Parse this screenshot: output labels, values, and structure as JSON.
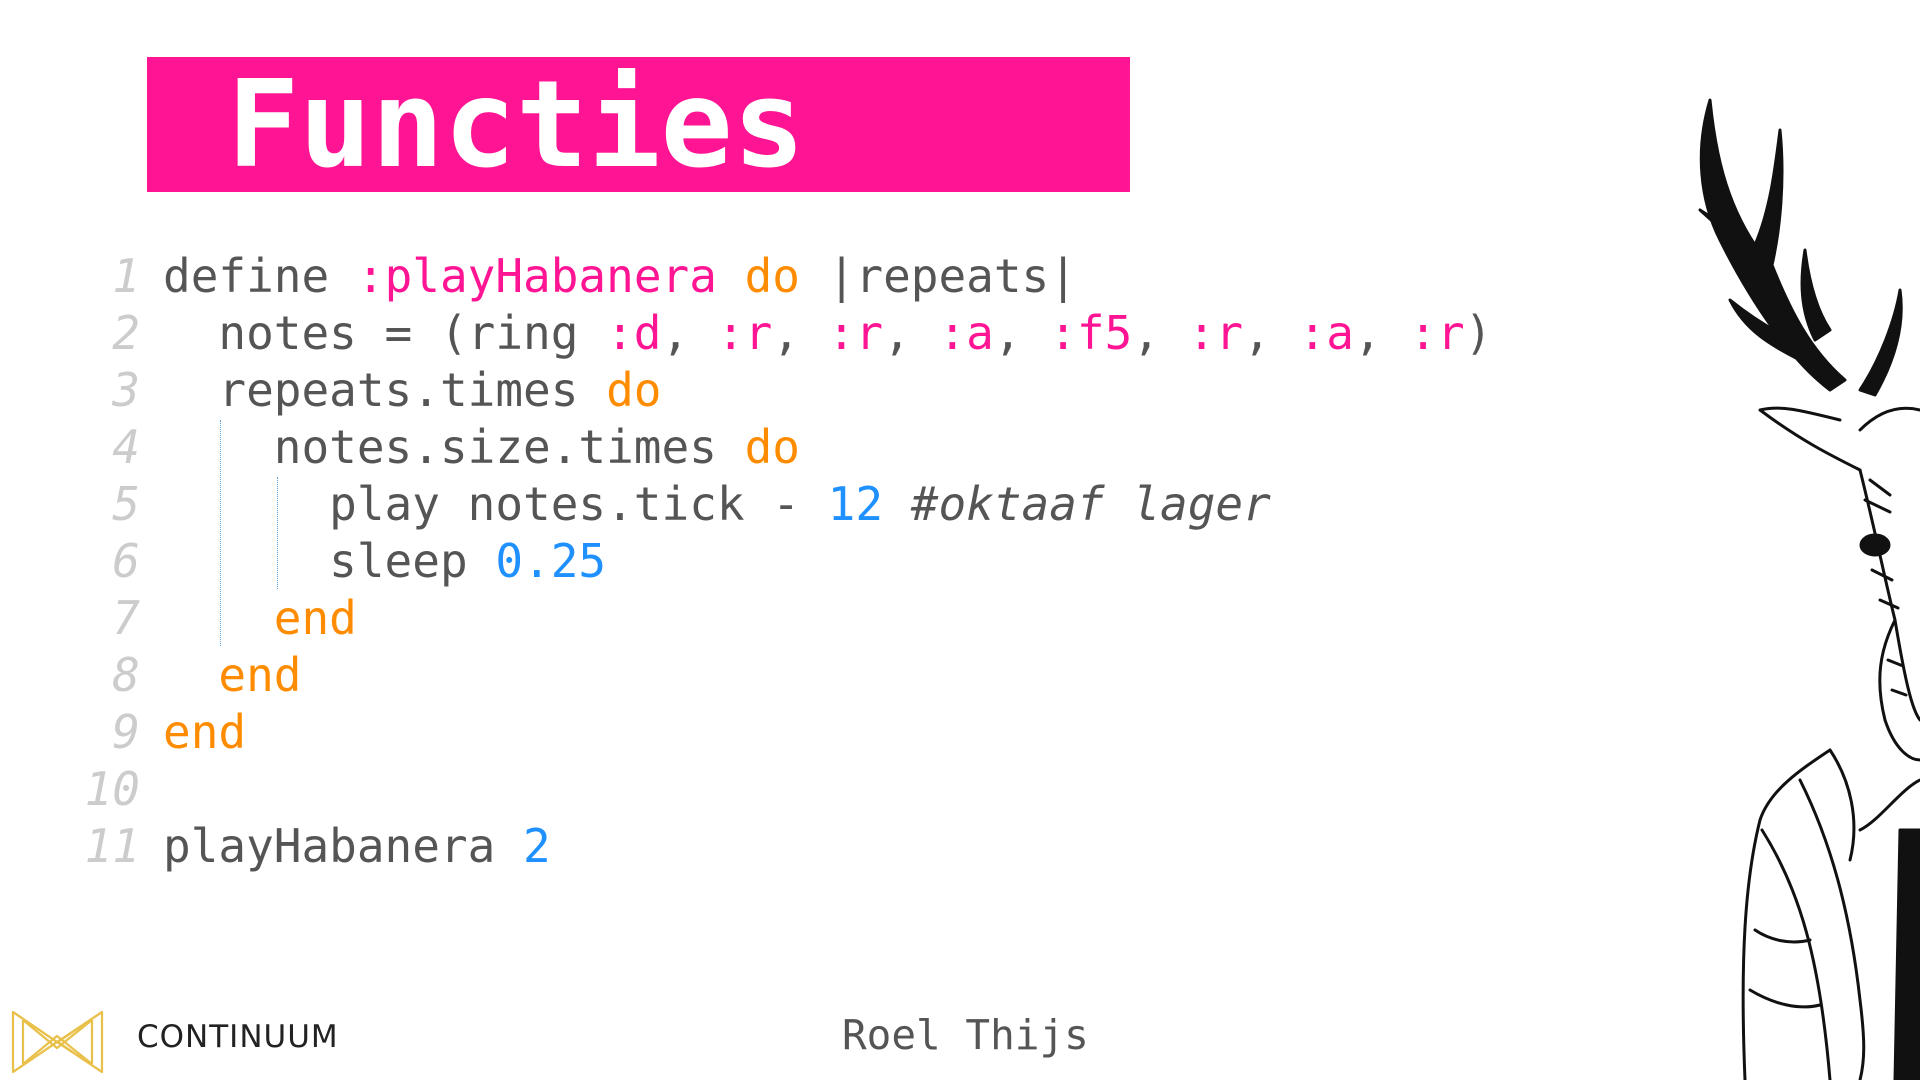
{
  "slide": {
    "title": "Functies",
    "author": "Roel Thijs",
    "brand": "CONTINUUM"
  },
  "colors": {
    "accent": "#ff1493",
    "keyword": "#ff8c00",
    "number": "#1e90ff",
    "text": "#555555",
    "line_number": "#cccccc",
    "logo": "#e8c04a"
  },
  "code": {
    "lines": [
      {
        "n": "1",
        "tokens": [
          [
            "",
            "define "
          ],
          [
            "sym",
            ":playHabanera"
          ],
          [
            "",
            " "
          ],
          [
            "kw",
            "do"
          ],
          [
            "",
            " |repeats|"
          ]
        ]
      },
      {
        "n": "2",
        "tokens": [
          [
            "",
            "  notes = (ring "
          ],
          [
            "sym",
            ":d"
          ],
          [
            "",
            ", "
          ],
          [
            "sym",
            ":r"
          ],
          [
            "",
            ", "
          ],
          [
            "sym",
            ":r"
          ],
          [
            "",
            ", "
          ],
          [
            "sym",
            ":a"
          ],
          [
            "",
            ", "
          ],
          [
            "sym",
            ":f5"
          ],
          [
            "",
            ", "
          ],
          [
            "sym",
            ":r"
          ],
          [
            "",
            ", "
          ],
          [
            "sym",
            ":a"
          ],
          [
            "",
            ", "
          ],
          [
            "sym",
            ":r"
          ],
          [
            "",
            ")"
          ]
        ]
      },
      {
        "n": "3",
        "tokens": [
          [
            "",
            "  repeats.times "
          ],
          [
            "kw",
            "do"
          ]
        ]
      },
      {
        "n": "4",
        "tokens": [
          [
            "",
            "    notes.size.times "
          ],
          [
            "kw",
            "do"
          ]
        ]
      },
      {
        "n": "5",
        "tokens": [
          [
            "",
            "      play notes.tick - "
          ],
          [
            "num",
            "12"
          ],
          [
            "",
            " "
          ],
          [
            "cmt",
            "#oktaaf lager"
          ]
        ]
      },
      {
        "n": "6",
        "tokens": [
          [
            "",
            "      sleep "
          ],
          [
            "num",
            "0.25"
          ]
        ]
      },
      {
        "n": "7",
        "tokens": [
          [
            "",
            "    "
          ],
          [
            "kw",
            "end"
          ]
        ]
      },
      {
        "n": "8",
        "tokens": [
          [
            "",
            "  "
          ],
          [
            "kw",
            "end"
          ]
        ]
      },
      {
        "n": "9",
        "tokens": [
          [
            "kw",
            "end"
          ]
        ]
      },
      {
        "n": "10",
        "tokens": []
      },
      {
        "n": "11",
        "tokens": [
          [
            "",
            "playHabanera "
          ],
          [
            "num",
            "2"
          ]
        ]
      }
    ]
  },
  "icons": {
    "logo": "continuum-logo-icon",
    "illustration": "deer-man-illustration"
  }
}
